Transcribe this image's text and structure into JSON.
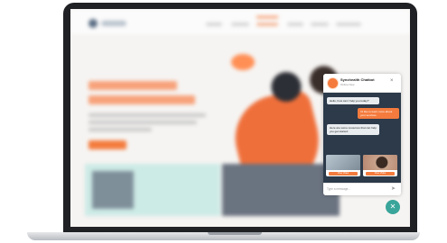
{
  "chat": {
    "title": "Synchealth Chatbot",
    "status": "Online Now",
    "close_label": "×",
    "messages": [
      {
        "from": "bot",
        "text": "Hello, how can I help you today?"
      },
      {
        "from": "user",
        "text": "I'd like to learn more about your services"
      },
      {
        "from": "bot",
        "text": "Here are some resources that can help you get started:"
      }
    ],
    "cards": [
      {
        "button": "View Video"
      },
      {
        "button": "View Video"
      }
    ],
    "input_placeholder": "Type a message...",
    "send_icon": "send-icon"
  },
  "launcher": {
    "label": "✕",
    "icon": "close-icon"
  },
  "colors": {
    "accent": "#f47b3d",
    "chat_body": "#2c3a4a",
    "launcher": "#3aa59a"
  }
}
